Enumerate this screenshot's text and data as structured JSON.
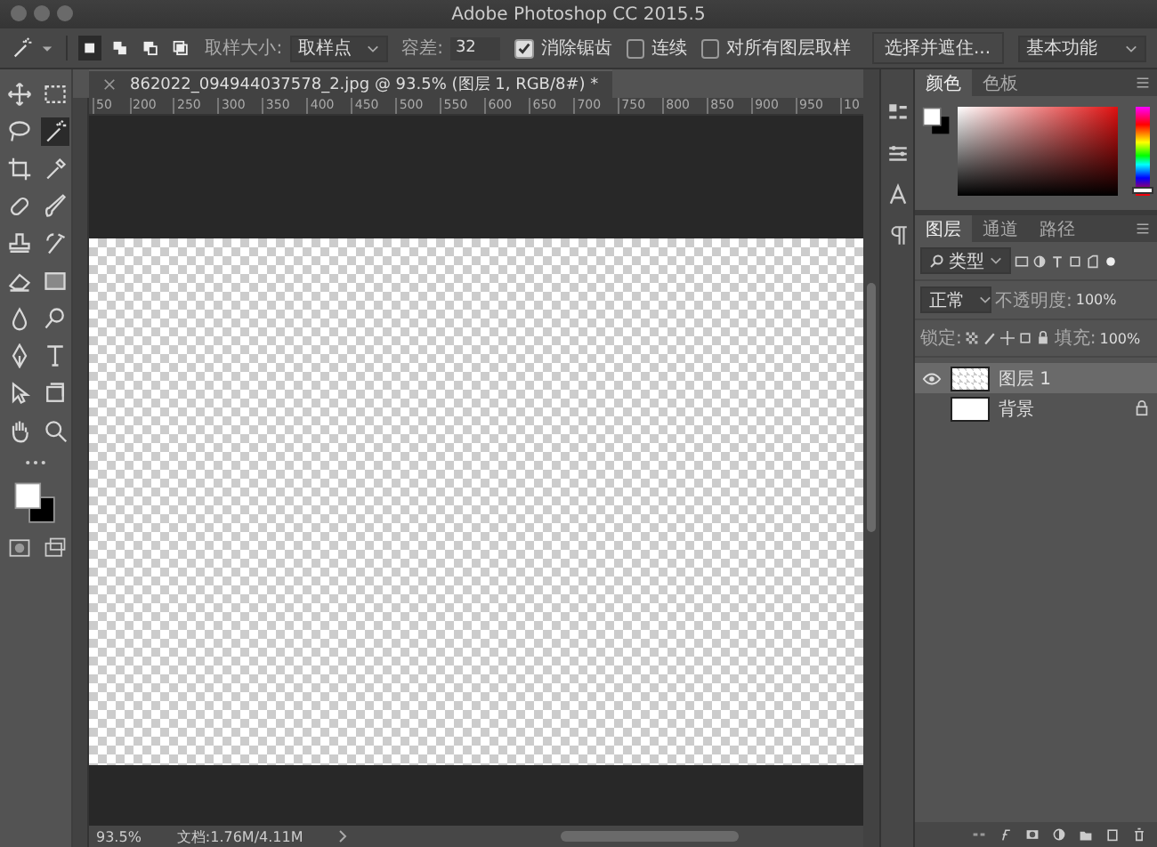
{
  "window": {
    "title": "Adobe Photoshop CC 2015.5"
  },
  "options_bar": {
    "sample_size_label": "取样大小:",
    "sample_size": "取样点",
    "tolerance_label": "容差:",
    "tolerance": "32",
    "checkboxes": [
      {
        "label": "消除锯齿",
        "checked": true
      },
      {
        "label": "连续",
        "checked": false
      },
      {
        "label": "对所有图层取样",
        "checked": false
      }
    ],
    "refine_button": "选择并遮住...",
    "workspace": "基本功能"
  },
  "tools": [
    {
      "kind": "move",
      "selected": false
    },
    {
      "kind": "marquee",
      "selected": false
    },
    {
      "kind": "lasso",
      "selected": false
    },
    {
      "kind": "wand",
      "selected": true
    },
    {
      "kind": "crop",
      "selected": false
    },
    {
      "kind": "eyedropper",
      "selected": false
    },
    {
      "kind": "bandage",
      "selected": false
    },
    {
      "kind": "brush",
      "selected": false
    },
    {
      "kind": "stamp",
      "selected": false
    },
    {
      "kind": "history",
      "selected": false
    },
    {
      "kind": "eraser",
      "selected": false
    },
    {
      "kind": "gradient",
      "selected": false
    },
    {
      "kind": "drop",
      "selected": false
    },
    {
      "kind": "dodge",
      "selected": false
    },
    {
      "kind": "pen",
      "selected": false
    },
    {
      "kind": "type",
      "selected": false
    },
    {
      "kind": "arrow",
      "selected": false
    },
    {
      "kind": "shape",
      "selected": false
    },
    {
      "kind": "hand",
      "selected": false
    },
    {
      "kind": "zoom",
      "selected": false
    }
  ],
  "document": {
    "tab": "862022_094944037578_2.jpg @ 93.5% (图层 1, RGB/8#) *",
    "ruler": [
      "50",
      "200",
      "250",
      "300",
      "350",
      "400",
      "450",
      "500",
      "550",
      "600",
      "650",
      "700",
      "750",
      "800",
      "850",
      "900",
      "950",
      "10"
    ]
  },
  "color_panel": {
    "tabs": [
      {
        "label": "颜色",
        "selected": true
      },
      {
        "label": "色板",
        "selected": false
      }
    ],
    "hue": {
      "level": 0.03
    }
  },
  "layers_panel": {
    "tabs": [
      {
        "label": "图层",
        "selected": true
      },
      {
        "label": "通道",
        "selected": false
      },
      {
        "label": "路径",
        "selected": false
      }
    ],
    "filter": "类型",
    "blend_mode": "正常",
    "opacity_label": "不透明度:",
    "opacity": "100%",
    "lock_label": "锁定:",
    "fill_label": "填充:",
    "fill": "100%",
    "layers": [
      {
        "name": "图层 1",
        "visible": true,
        "selected": true,
        "locked": false,
        "transparent": true
      },
      {
        "name": "背景",
        "visible": false,
        "selected": false,
        "locked": true,
        "transparent": false
      }
    ]
  },
  "status_bar": {
    "zoom": "93.5%",
    "doc_size": "文档:1.76M/4.11M"
  }
}
